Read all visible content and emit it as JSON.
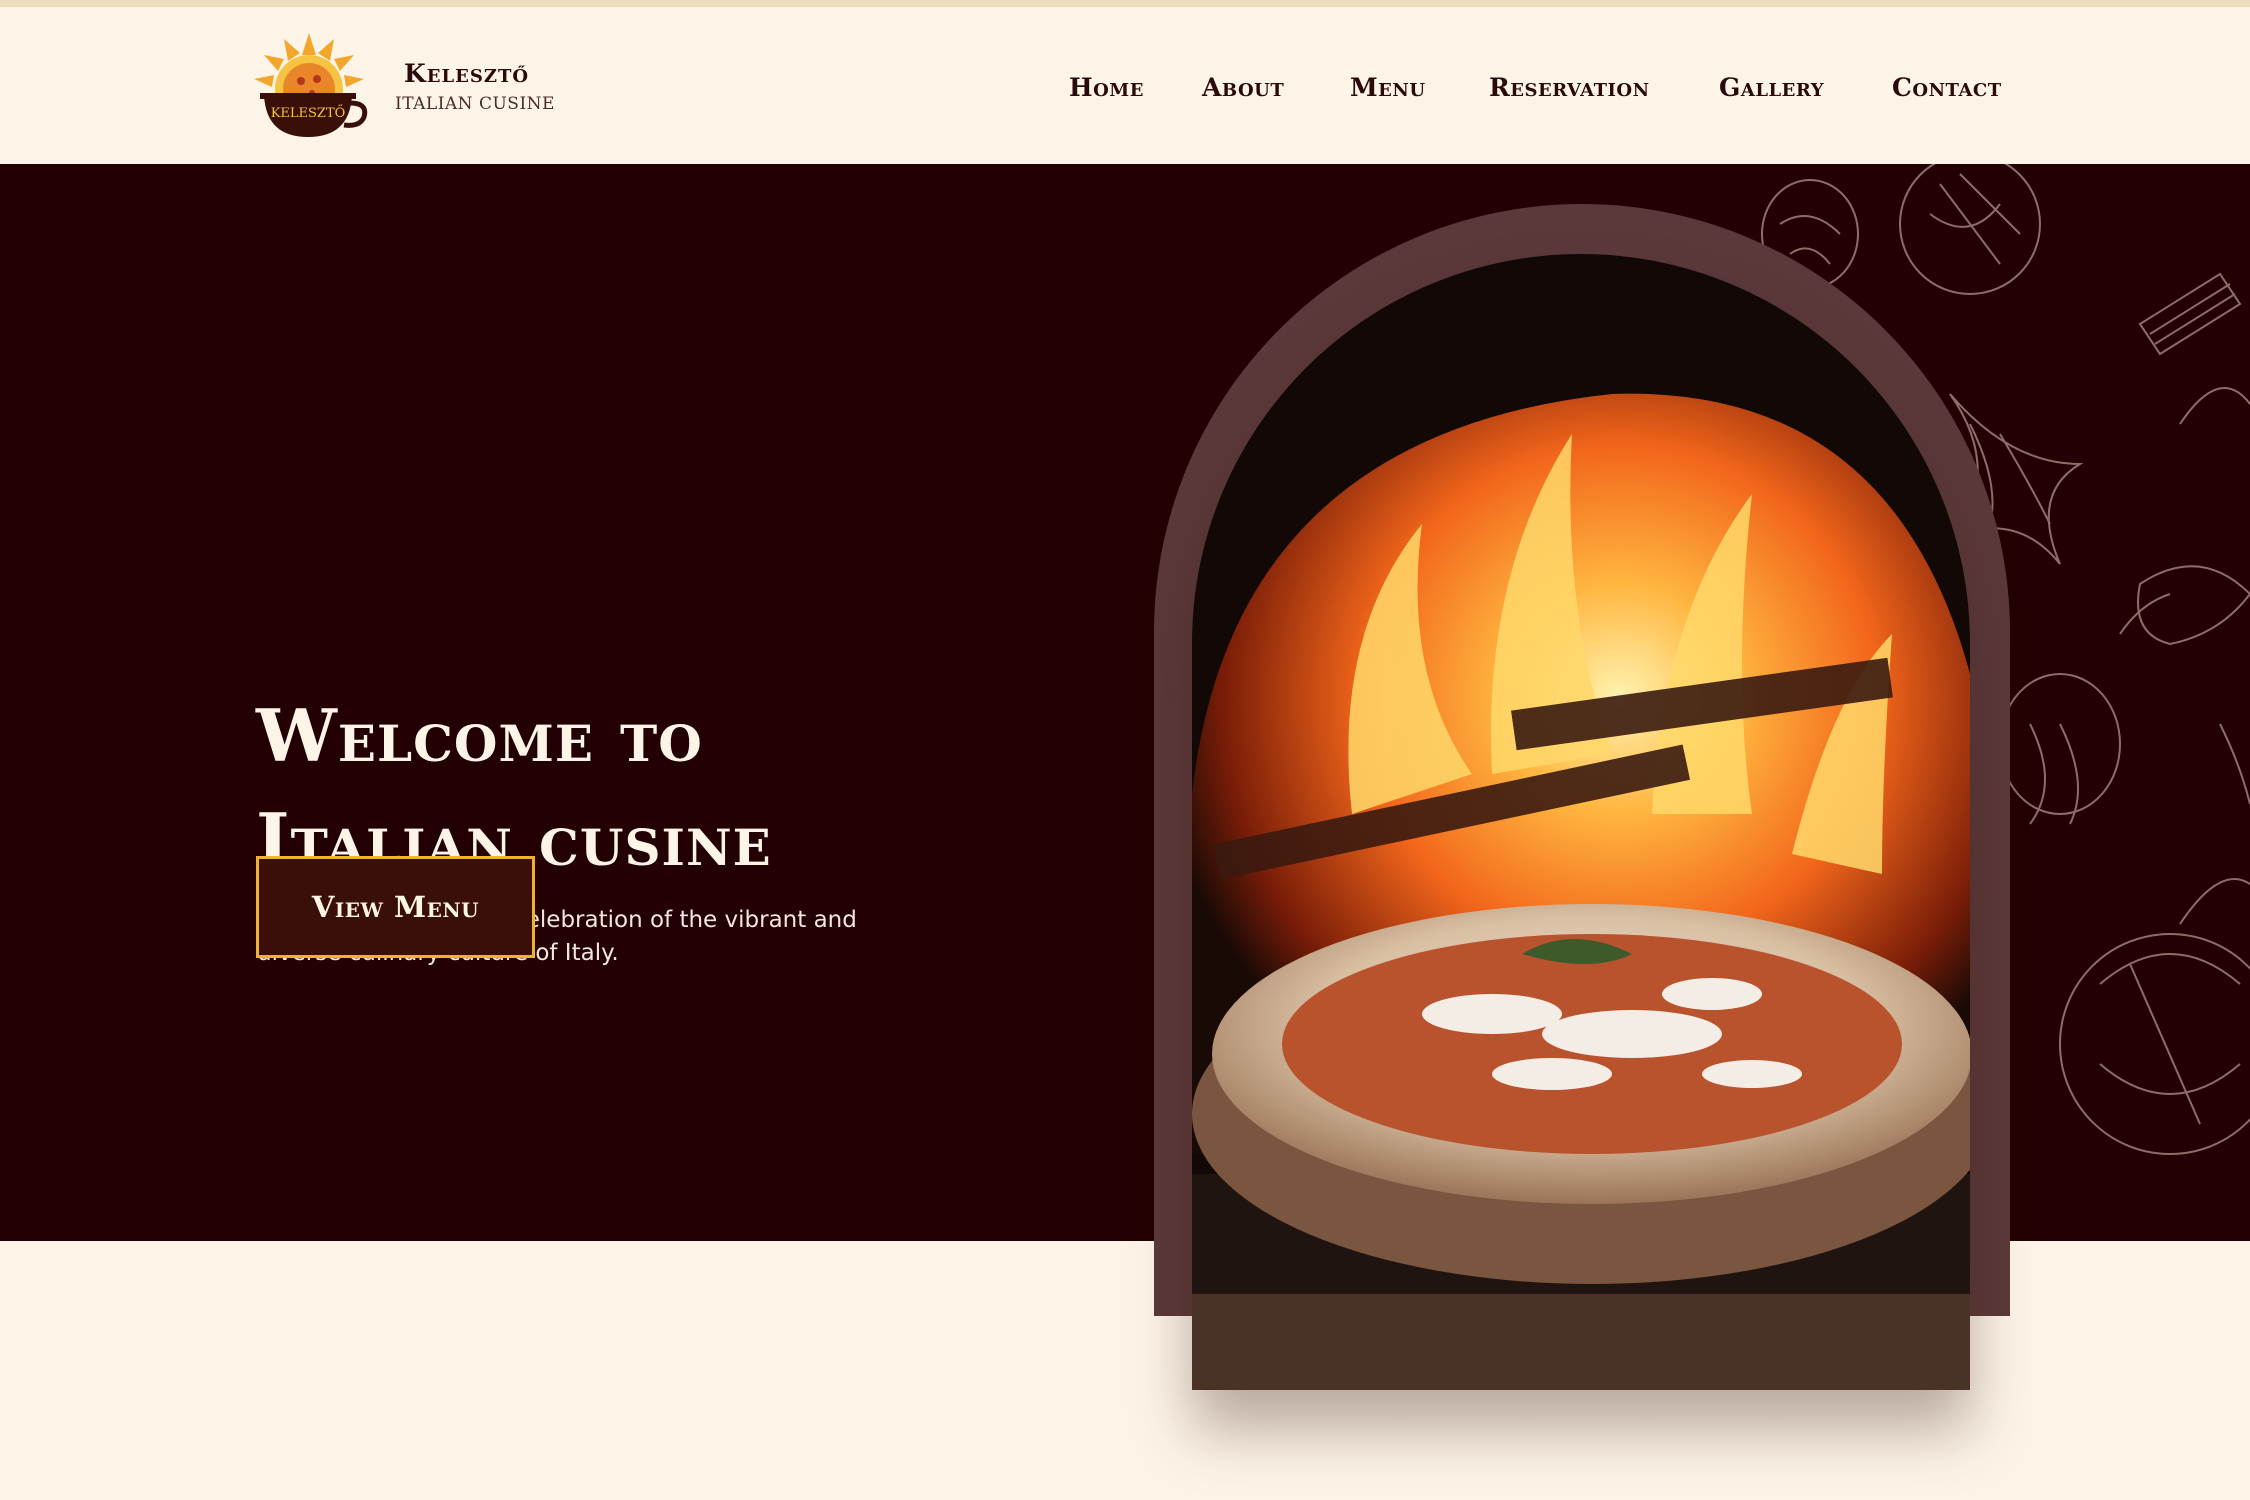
{
  "brand": {
    "name": "Kelesztő",
    "tagline": "ITALIAN CUSINE",
    "logo_text": "KELESZTŐ"
  },
  "nav": {
    "items": [
      {
        "label": "Home"
      },
      {
        "label": "About"
      },
      {
        "label": "Menu"
      },
      {
        "label": "Reservation"
      },
      {
        "label": "Gallery"
      },
      {
        "label": "Contact"
      }
    ]
  },
  "hero": {
    "title_line1": "Welcome to",
    "title_line2": "Italian cusine",
    "subtitle_line1": "Where every dish is a celebration of the vibrant and",
    "subtitle_line2": "diverse culinary culture of Italy.",
    "cta_label": "View Menu",
    "image": "pizza-in-wood-fired-oven"
  },
  "colors": {
    "page_bg": "#fdf4e8",
    "hero_bg": "#230003",
    "accent": "#f0b232",
    "arch_frame": "#5b393a",
    "text_dark": "#2a0a0a"
  }
}
